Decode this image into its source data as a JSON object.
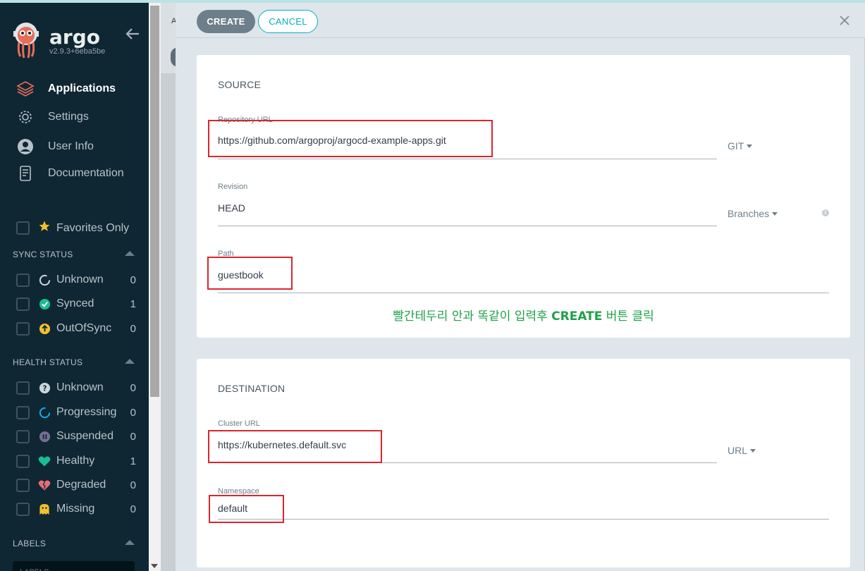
{
  "app": {
    "brand": "argo",
    "version": "v2.9.3+6eba5be"
  },
  "nav": [
    {
      "label": "Applications",
      "icon": "stack-icon",
      "active": true
    },
    {
      "label": "Settings",
      "icon": "gear-icon",
      "active": false
    },
    {
      "label": "User Info",
      "icon": "user-icon",
      "active": false
    },
    {
      "label": "Documentation",
      "icon": "book-icon",
      "active": false
    }
  ],
  "favorites": {
    "label": "Favorites Only"
  },
  "sync_status": {
    "title": "SYNC STATUS",
    "items": [
      {
        "label": "Unknown",
        "count": "0",
        "icon": "circle-notch-icon"
      },
      {
        "label": "Synced",
        "count": "1",
        "icon": "check-circle-icon"
      },
      {
        "label": "OutOfSync",
        "count": "0",
        "icon": "arrow-up-circle-icon"
      }
    ]
  },
  "health_status": {
    "title": "HEALTH STATUS",
    "items": [
      {
        "label": "Unknown",
        "count": "0",
        "icon": "question-circle-icon"
      },
      {
        "label": "Progressing",
        "count": "0",
        "icon": "spinner-icon"
      },
      {
        "label": "Suspended",
        "count": "0",
        "icon": "pause-circle-icon"
      },
      {
        "label": "Healthy",
        "count": "1",
        "icon": "heart-icon"
      },
      {
        "label": "Degraded",
        "count": "0",
        "icon": "broken-heart-icon"
      },
      {
        "label": "Missing",
        "count": "0",
        "icon": "ghost-icon"
      }
    ]
  },
  "labels_section": {
    "title": "LABELS",
    "placeholder": "LABELS"
  },
  "underlay": {
    "letter": "A"
  },
  "toolbar": {
    "create_label": "CREATE",
    "cancel_label": "CANCEL"
  },
  "source": {
    "title": "SOURCE",
    "repo_url": {
      "label": "Repository URL",
      "value": "https://github.com/argoproj/argocd-example-apps.git",
      "type": "GIT"
    },
    "revision": {
      "label": "Revision",
      "value": "HEAD",
      "type": "Branches"
    },
    "path": {
      "label": "Path",
      "value": "guestbook"
    }
  },
  "annotation": {
    "before": "빨간테두리 안과 똑같이 입력후 ",
    "bold": "CREATE",
    "after": " 버튼 클릭"
  },
  "destination": {
    "title": "DESTINATION",
    "cluster_url": {
      "label": "Cluster URL",
      "value": "https://kubernetes.default.svc",
      "type": "URL"
    },
    "namespace": {
      "label": "Namespace",
      "value": "default"
    }
  },
  "colors": {
    "sidebar_bg": "#0f2733",
    "accent_teal": "#0dadbe",
    "create_btn": "#6d7f8b",
    "highlight_red": "#d9262e",
    "annotation_green": "#1fa04a"
  }
}
